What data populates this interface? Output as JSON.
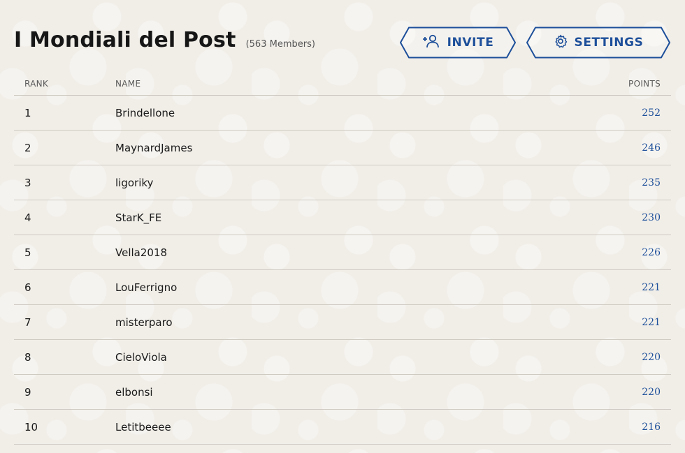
{
  "header": {
    "title": "I Mondiali del Post",
    "members": "(563 Members)"
  },
  "buttons": {
    "invite_label": "INVITE",
    "settings_label": "SETTINGS"
  },
  "table": {
    "columns": {
      "rank": "RANK",
      "name": "NAME",
      "points": "POINTS"
    },
    "rows": [
      {
        "rank": "1",
        "name": "Brindellone",
        "points": "252"
      },
      {
        "rank": "2",
        "name": "MaynardJames",
        "points": "246"
      },
      {
        "rank": "3",
        "name": "ligoriky",
        "points": "235"
      },
      {
        "rank": "4",
        "name": "StarK_FE",
        "points": "230"
      },
      {
        "rank": "5",
        "name": "Vella2018",
        "points": "226"
      },
      {
        "rank": "6",
        "name": "LouFerrigno",
        "points": "221"
      },
      {
        "rank": "7",
        "name": "misterparo",
        "points": "221"
      },
      {
        "rank": "8",
        "name": "CieloViola",
        "points": "220"
      },
      {
        "rank": "9",
        "name": "elbonsi",
        "points": "220"
      },
      {
        "rank": "10",
        "name": "Letitbeeee",
        "points": "216"
      }
    ]
  },
  "colors": {
    "accent": "#1d4f9a",
    "background": "#f1eee8"
  },
  "icons": {
    "invite": "add-user-icon",
    "settings": "gear-icon"
  }
}
